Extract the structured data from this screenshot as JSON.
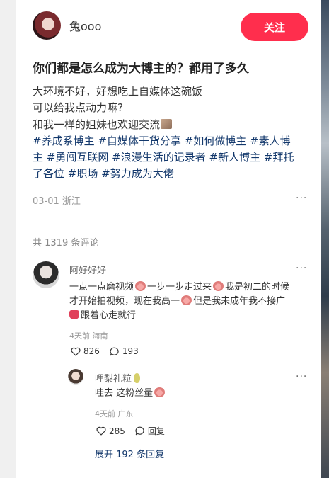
{
  "author": {
    "name": "兔ooo",
    "follow_label": "关注"
  },
  "note": {
    "title": "你们都是怎么成为大博主的？都用了多久",
    "body_lines": [
      "大环境不好，好想吃上自媒体这碗饭",
      "可以给我点动力嘛?",
      "和我一样的姐妹也欢迎交流"
    ],
    "tag_lines": [
      [
        "#养成系博主",
        "#自媒体干货分享",
        "#如何做博主",
        "#素人博"
      ],
      [
        "主",
        "#勇闯互联网",
        "#浪漫生活的记录者",
        "#新人博主",
        "#拜托"
      ],
      [
        "了各位",
        "#职场",
        "#努力成为大佬"
      ]
    ],
    "date_location": "03-01 浙江"
  },
  "comments_header": "共 1319 条评论",
  "comments": [
    {
      "name": "阿好好好",
      "text_lines": [
        {
          "a": "一点一点磨视频",
          "b": "一步一步走过来",
          "c": "我是初二的时候"
        },
        {
          "a": "才开始拍视频，现在我高一",
          "b": "但是我未成年我不接广"
        },
        {
          "a": "跟着心走就行"
        }
      ],
      "meta": "4天前 海南",
      "likes": "826",
      "replies_count": "193"
    }
  ],
  "reply": {
    "name": "哩梨礼粒",
    "text": "哇去 这粉丝量",
    "meta": "4天前 广东",
    "likes": "285",
    "reply_label": "回复"
  },
  "expand_label": "展开 192 条回复",
  "icons": {
    "more": "more-dots-icon",
    "like": "heart-outline-icon",
    "comment": "speech-bubble-icon"
  },
  "colors": {
    "accent": "#ff2e4d",
    "tag": "#13386c"
  }
}
